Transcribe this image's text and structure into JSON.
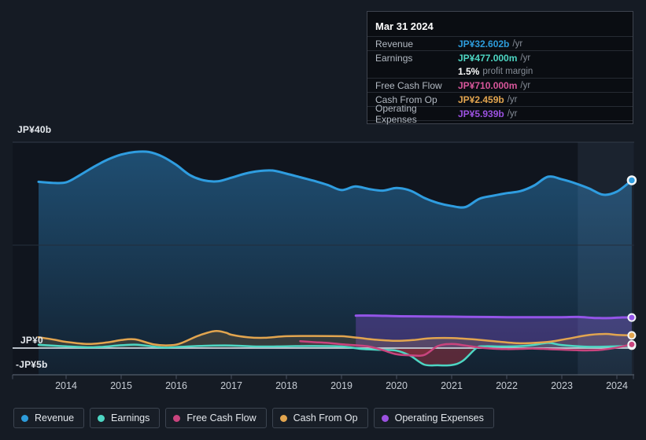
{
  "tooltip": {
    "date": "Mar 31 2024",
    "rows": [
      {
        "label": "Revenue",
        "value": "JP¥32.602b",
        "suffix": "/yr",
        "color": "#2D9CDB"
      },
      {
        "label": "Earnings",
        "value": "JP¥477.000m",
        "suffix": "/yr",
        "color": "#4DD6C3",
        "margin_value": "1.5%",
        "margin_label": "profit margin"
      },
      {
        "label": "Free Cash Flow",
        "value": "JP¥710.000m",
        "suffix": "/yr",
        "color": "#D8569B"
      },
      {
        "label": "Cash From Op",
        "value": "JP¥2.459b",
        "suffix": "/yr",
        "color": "#E2A54F"
      },
      {
        "label": "Operating Expenses",
        "value": "JP¥5.939b",
        "suffix": "/yr",
        "color": "#9B51E0"
      }
    ]
  },
  "axis": {
    "y_labels": [
      {
        "text": "JP¥40b",
        "value": 40
      },
      {
        "text": "JP¥0",
        "value": 0
      },
      {
        "text": "-JP¥5b",
        "value": -5
      }
    ],
    "x_labels": [
      "2014",
      "2015",
      "2016",
      "2017",
      "2018",
      "2019",
      "2020",
      "2021",
      "2022",
      "2023",
      "2024"
    ]
  },
  "legend": {
    "items": [
      {
        "label": "Revenue",
        "color": "#2D9CDB"
      },
      {
        "label": "Earnings",
        "color": "#4DD6C3"
      },
      {
        "label": "Free Cash Flow",
        "color": "#C9447E"
      },
      {
        "label": "Cash From Op",
        "color": "#E2A54F"
      },
      {
        "label": "Operating Expenses",
        "color": "#9B51E0"
      }
    ]
  },
  "chart_data": {
    "type": "area",
    "title": "Earnings and revenue history",
    "x_unit": "year",
    "y_unit": "JP¥ billions",
    "ylim": [
      -5.3,
      40
    ],
    "y_gridlines": [
      40,
      20,
      0,
      -5
    ],
    "hover_band_years": [
      2023.29,
      2024.31
    ],
    "hover_point_year": 2024.27,
    "series": [
      {
        "name": "Revenue",
        "color": "#2F9DE0",
        "points": [
          [
            2013.5,
            32.3
          ],
          [
            2013.75,
            32.1
          ],
          [
            2014,
            32.2
          ],
          [
            2014.25,
            33.6
          ],
          [
            2014.5,
            35.2
          ],
          [
            2014.75,
            36.6
          ],
          [
            2015,
            37.6
          ],
          [
            2015.25,
            38.1
          ],
          [
            2015.5,
            38.1
          ],
          [
            2015.75,
            37.2
          ],
          [
            2016,
            35.6
          ],
          [
            2016.25,
            33.6
          ],
          [
            2016.5,
            32.6
          ],
          [
            2016.75,
            32.4
          ],
          [
            2017,
            33.1
          ],
          [
            2017.25,
            33.9
          ],
          [
            2017.5,
            34.4
          ],
          [
            2017.75,
            34.5
          ],
          [
            2018,
            33.9
          ],
          [
            2018.25,
            33.2
          ],
          [
            2018.5,
            32.5
          ],
          [
            2018.75,
            31.7
          ],
          [
            2019,
            30.7
          ],
          [
            2019.25,
            31.4
          ],
          [
            2019.5,
            30.9
          ],
          [
            2019.75,
            30.6
          ],
          [
            2020,
            31.1
          ],
          [
            2020.25,
            30.6
          ],
          [
            2020.5,
            29.2
          ],
          [
            2020.75,
            28.2
          ],
          [
            2021,
            27.6
          ],
          [
            2021.25,
            27.4
          ],
          [
            2021.5,
            29
          ],
          [
            2021.75,
            29.6
          ],
          [
            2022,
            30.1
          ],
          [
            2022.25,
            30.5
          ],
          [
            2022.5,
            31.6
          ],
          [
            2022.75,
            33.3
          ],
          [
            2023,
            32.8
          ],
          [
            2023.25,
            32
          ],
          [
            2023.5,
            31
          ],
          [
            2023.75,
            29.8
          ],
          [
            2024,
            30.4
          ],
          [
            2024.27,
            32.602
          ]
        ]
      },
      {
        "name": "Earnings",
        "color": "#4DD6C3",
        "points": [
          [
            2013.5,
            0.65
          ],
          [
            2014,
            0.35
          ],
          [
            2014.5,
            0.15
          ],
          [
            2015,
            0.55
          ],
          [
            2015.3,
            0.65
          ],
          [
            2015.75,
            0.1
          ],
          [
            2016,
            0.2
          ],
          [
            2016.5,
            0.45
          ],
          [
            2017,
            0.5
          ],
          [
            2017.5,
            0.3
          ],
          [
            2018,
            0.35
          ],
          [
            2018.5,
            0.4
          ],
          [
            2019,
            0.3
          ],
          [
            2019.4,
            -0.2
          ],
          [
            2019.75,
            -0.35
          ],
          [
            2020,
            -0.5
          ],
          [
            2020.25,
            -1.5
          ],
          [
            2020.5,
            -3.2
          ],
          [
            2020.75,
            -3.35
          ],
          [
            2021,
            -3.3
          ],
          [
            2021.2,
            -2.5
          ],
          [
            2021.45,
            0
          ],
          [
            2021.6,
            0.35
          ],
          [
            2022,
            0.3
          ],
          [
            2022.4,
            0.5
          ],
          [
            2022.75,
            1
          ],
          [
            2023,
            0.6
          ],
          [
            2023.5,
            0.25
          ],
          [
            2024,
            0.35
          ],
          [
            2024.27,
            0.477
          ]
        ]
      },
      {
        "name": "Free Cash Flow",
        "color": "#C9447E",
        "points": [
          [
            2018.25,
            1.35
          ],
          [
            2018.5,
            1.15
          ],
          [
            2018.75,
            1
          ],
          [
            2019,
            0.75
          ],
          [
            2019.25,
            0.55
          ],
          [
            2019.5,
            0.3
          ],
          [
            2019.75,
            -0.4
          ],
          [
            2020,
            -1.2
          ],
          [
            2020.25,
            -1.4
          ],
          [
            2020.5,
            -1.35
          ],
          [
            2020.75,
            0.4
          ],
          [
            2021,
            0.8
          ],
          [
            2021.25,
            0.5
          ],
          [
            2021.5,
            0.1
          ],
          [
            2021.75,
            -0.1
          ],
          [
            2022,
            -0.2
          ],
          [
            2022.25,
            -0.15
          ],
          [
            2022.5,
            -0.1
          ],
          [
            2022.75,
            -0.2
          ],
          [
            2023,
            -0.3
          ],
          [
            2023.25,
            -0.4
          ],
          [
            2023.5,
            -0.45
          ],
          [
            2023.75,
            -0.3
          ],
          [
            2024,
            0.1
          ],
          [
            2024.27,
            0.71
          ]
        ]
      },
      {
        "name": "Cash From Op",
        "color": "#E2A54F",
        "points": [
          [
            2013.5,
            2.1
          ],
          [
            2013.8,
            1.6
          ],
          [
            2014,
            1.2
          ],
          [
            2014.4,
            0.8
          ],
          [
            2014.75,
            1.1
          ],
          [
            2015,
            1.55
          ],
          [
            2015.25,
            1.7
          ],
          [
            2015.6,
            0.7
          ],
          [
            2015.9,
            0.55
          ],
          [
            2016.1,
            1
          ],
          [
            2016.4,
            2.4
          ],
          [
            2016.7,
            3.3
          ],
          [
            2016.9,
            3
          ],
          [
            2017,
            2.6
          ],
          [
            2017.3,
            2.1
          ],
          [
            2017.6,
            2
          ],
          [
            2018,
            2.3
          ],
          [
            2018.5,
            2.35
          ],
          [
            2019,
            2.3
          ],
          [
            2019.3,
            2
          ],
          [
            2019.6,
            1.65
          ],
          [
            2020,
            1.4
          ],
          [
            2020.3,
            1.55
          ],
          [
            2020.6,
            1.9
          ],
          [
            2021,
            1.95
          ],
          [
            2021.4,
            1.7
          ],
          [
            2021.8,
            1.3
          ],
          [
            2022.2,
            0.95
          ],
          [
            2022.5,
            1
          ],
          [
            2022.8,
            1.25
          ],
          [
            2023.1,
            1.8
          ],
          [
            2023.5,
            2.55
          ],
          [
            2023.8,
            2.75
          ],
          [
            2024,
            2.55
          ],
          [
            2024.27,
            2.459
          ]
        ]
      },
      {
        "name": "Operating Expenses",
        "color": "#9455E8",
        "points": [
          [
            2019.26,
            6.3
          ],
          [
            2019.6,
            6.3
          ],
          [
            2020,
            6.2
          ],
          [
            2020.5,
            6.15
          ],
          [
            2021,
            6.1
          ],
          [
            2021.5,
            6.05
          ],
          [
            2022,
            6
          ],
          [
            2022.5,
            6
          ],
          [
            2023,
            6
          ],
          [
            2023.3,
            6.05
          ],
          [
            2023.6,
            5.85
          ],
          [
            2023.9,
            5.85
          ],
          [
            2024.1,
            5.95
          ],
          [
            2024.27,
            5.939
          ]
        ]
      }
    ]
  }
}
